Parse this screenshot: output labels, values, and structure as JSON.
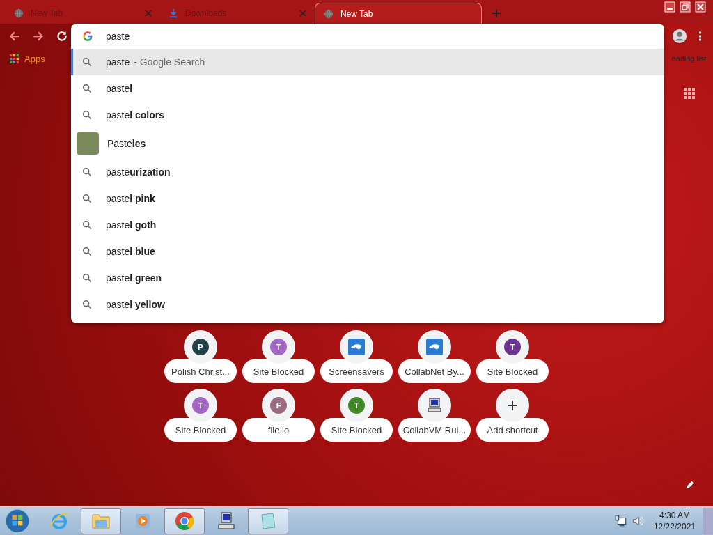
{
  "tabs": [
    {
      "title": "New Tab",
      "kind": "page",
      "selected": false
    },
    {
      "title": "Downloads",
      "kind": "download",
      "selected": false
    },
    {
      "title": "New Tab",
      "kind": "page",
      "selected": true
    }
  ],
  "bookmarks_bar": {
    "apps_label": "Apps",
    "reading_list": "eading list"
  },
  "omnibox": {
    "value": "paste",
    "suggestions": [
      {
        "kind": "search",
        "text": "paste",
        "description": "- Google Search",
        "selected": true
      },
      {
        "kind": "search",
        "text": "paste**l**",
        "selected": false
      },
      {
        "kind": "search",
        "text": "paste**l colors**",
        "selected": false
      },
      {
        "kind": "entity",
        "text": "Paste**les**",
        "selected": false
      },
      {
        "kind": "search",
        "text": "paste**urization**",
        "selected": false
      },
      {
        "kind": "search",
        "text": "paste**l pink**",
        "selected": false
      },
      {
        "kind": "search",
        "text": "paste**l goth**",
        "selected": false
      },
      {
        "kind": "search",
        "text": "paste**l blue**",
        "selected": false
      },
      {
        "kind": "search",
        "text": "paste**l green**",
        "selected": false
      },
      {
        "kind": "search",
        "text": "paste**l yellow**",
        "selected": false
      }
    ]
  },
  "shortcuts": [
    {
      "kind": "letter",
      "letter": "P",
      "color": "#24424a",
      "title": "Polish Christ..."
    },
    {
      "kind": "letter",
      "letter": "T",
      "color": "#a266c4",
      "title": "Site Blocked"
    },
    {
      "kind": "favicon",
      "title": "Screensavers"
    },
    {
      "kind": "favicon",
      "title": "CollabNet By..."
    },
    {
      "kind": "letter",
      "letter": "T",
      "color": "#6b3591",
      "title": "Site Blocked"
    },
    {
      "kind": "letter",
      "letter": "T",
      "color": "#a266c4",
      "title": "Site Blocked"
    },
    {
      "kind": "letter",
      "letter": "F",
      "color": "#9b6b80",
      "title": "file.io"
    },
    {
      "kind": "letter",
      "letter": "T",
      "color": "#3f8a25",
      "title": "Site Blocked"
    },
    {
      "kind": "computer",
      "title": "CollabVM Rul..."
    },
    {
      "kind": "add",
      "title": "Add shortcut"
    }
  ],
  "taskbar": {
    "items": [
      {
        "kind": "ie",
        "open": false
      },
      {
        "kind": "folder",
        "open": true
      },
      {
        "kind": "media",
        "open": false
      },
      {
        "kind": "chrome",
        "open": true
      },
      {
        "kind": "computer",
        "open": false
      },
      {
        "kind": "notepad",
        "open": true
      }
    ],
    "clock": {
      "time": "4:30 AM",
      "date": "12/22/2021"
    }
  }
}
